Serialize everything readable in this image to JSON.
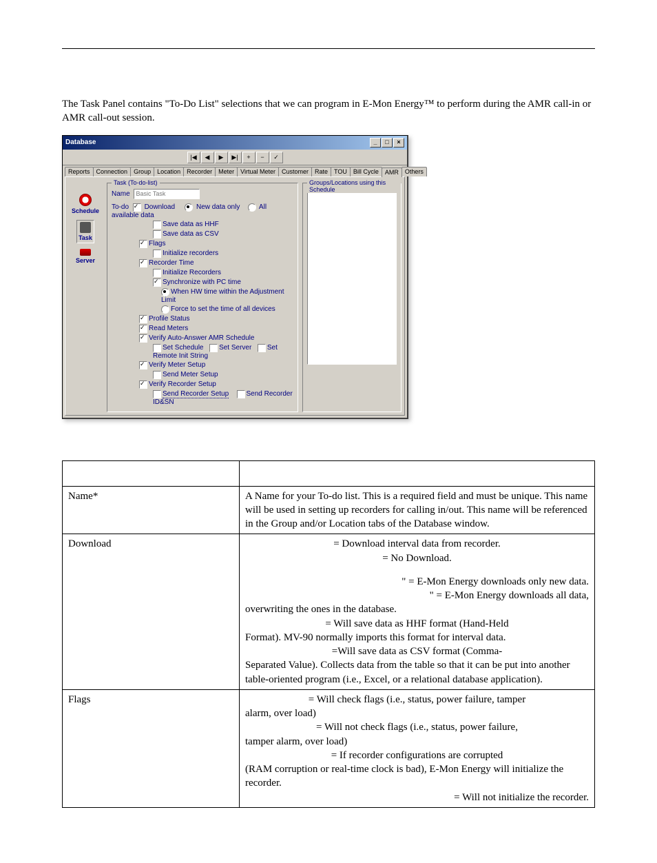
{
  "intro": "The Task Panel contains \"To-Do List\" selections that we can program in E-Mon Energy™ to perform during the AMR call-in or AMR call-out session.",
  "win": {
    "title": "Database",
    "title_btns": {
      "min": "_",
      "max": "□",
      "close": "×"
    },
    "toolbar": {
      "first": "|◀",
      "prev": "◀",
      "next": "▶",
      "last": "▶|",
      "add": "+",
      "del": "−",
      "ok": "✓"
    },
    "tabs": [
      "Reports",
      "Connection",
      "Group",
      "Location",
      "Recorder",
      "Meter",
      "Virtual Meter",
      "Customer",
      "Rate",
      "TOU",
      "Bill Cycle",
      "AMR",
      "Others"
    ],
    "active_tab_index": 11,
    "sidebar": [
      {
        "label": "Schedule",
        "icon": "clock"
      },
      {
        "label": "Task",
        "icon": "gear",
        "active": true
      },
      {
        "label": "Server",
        "icon": "srv"
      }
    ],
    "right_group_legend": "Groups/Locations using this Schedule",
    "task": {
      "legend": "Task (To-do-list)",
      "name_label": "Name",
      "name_value": "Basic Task",
      "todo_label": "To-do",
      "download": "Download",
      "new_data_only": "New data only",
      "all_available": "All available data",
      "save_hhf": "Save data as HHF",
      "save_csv": "Save data as CSV",
      "flags": "Flags",
      "init_recorders": "Initialize recorders",
      "recorder_time": "Recorder Time",
      "init_recorders2": "Initialize Recorders",
      "sync_pc_time": "Synchronize with PC time",
      "when_hw": "When HW time within the Adjustment Limit",
      "force_set": "Force to set the time of all devices",
      "profile_status": "Profile Status",
      "read_meters": "Read Meters",
      "verify_amr": "Verify Auto-Answer AMR Schedule",
      "set_schedule": "Set Schedule",
      "set_server": "Set Server",
      "set_remote_init": "Set Remote Init String",
      "verify_meter_setup": "Verify Meter Setup",
      "send_meter_setup": "Send Meter Setup",
      "verify_rec_setup": "Verify Recorder Setup",
      "send_rec_setup": "Send Recorder Setup",
      "send_rec_idsn": "Send Recorder ID&SN"
    }
  },
  "rows": {
    "name": {
      "field": "Name*",
      "desc": "A Name for your To-do list. This is a required field and must be unique. This name will be used in setting up recorders for calling in/out. This name will be referenced in the Group and/or Location tabs of the Database window."
    },
    "download": {
      "field": "Download",
      "l1": "= Download interval data from recorder.",
      "l2": "= No Download.",
      "l3": "\" = E-Mon Energy downloads only new data.",
      "l4": "\" = E-Mon Energy downloads all data, overwriting the ones in the database.",
      "l5": "= Will save data as HHF format (Hand-Held Format).  MV-90 normally imports this format for interval data.",
      "l6": "=Will save data as CSV format (Comma-Separated Value).  Collects data from the table so that it can be put into another table-oriented program (i.e., Excel, or a relational database application)."
    },
    "flags": {
      "field": "Flags",
      "l1": "= Will check flags (i.e., status, power failure, tamper alarm, over load)",
      "l2": "= Will not check flags (i.e., status, power failure, tamper alarm, over load)",
      "l3": "= If recorder configurations are corrupted (RAM corruption or real-time clock is bad), E-Mon Energy will initialize the recorder.",
      "l4": "= Will not initialize the recorder."
    }
  }
}
